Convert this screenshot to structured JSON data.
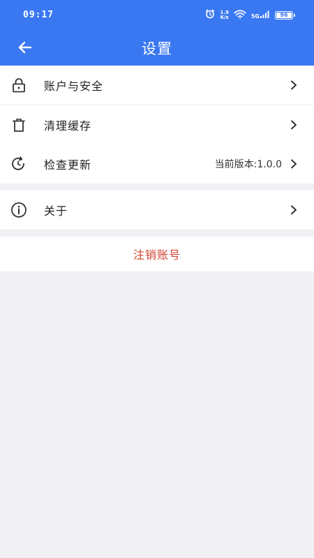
{
  "status_bar": {
    "time": "09:17",
    "net_speed_value": "1.9",
    "net_speed_unit": "K/s",
    "network_type": "5G",
    "battery_level": "96"
  },
  "header": {
    "title": "设置"
  },
  "settings": {
    "group1": [
      {
        "label": "账户与安全",
        "icon": "lock-icon"
      },
      {
        "label": "清理缓存",
        "icon": "trash-icon"
      },
      {
        "label": "检查更新",
        "icon": "refresh-icon",
        "value": "当前版本:1.0.0"
      }
    ],
    "group2": [
      {
        "label": "关于",
        "icon": "info-icon"
      }
    ]
  },
  "logout": {
    "label": "注销账号"
  },
  "colors": {
    "primary": "#3a78f2",
    "danger": "#d2412e",
    "background": "#f0f0f5"
  }
}
